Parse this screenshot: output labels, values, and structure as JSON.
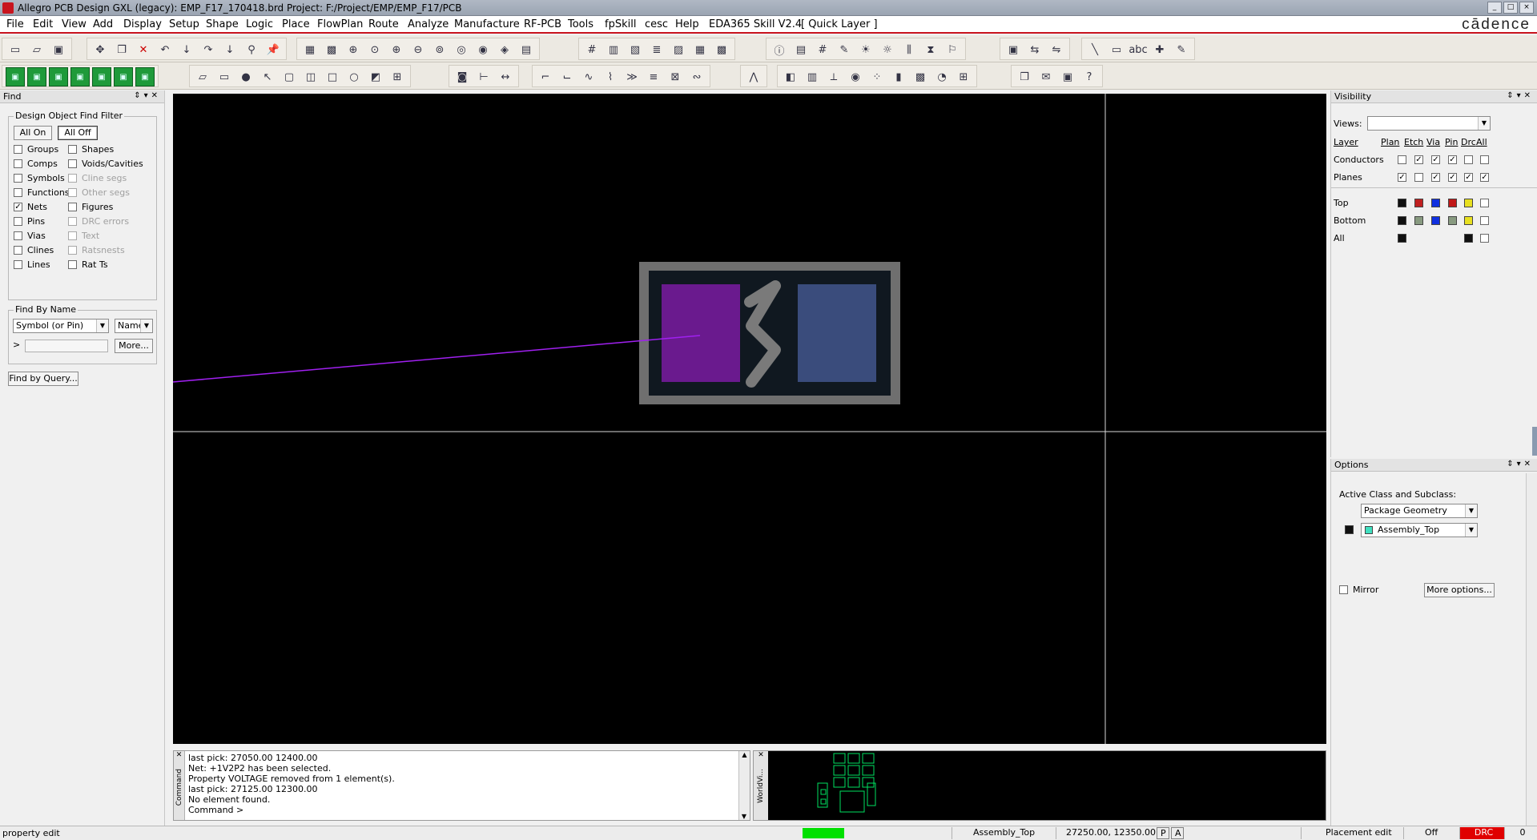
{
  "window": {
    "title": "Allegro PCB Design GXL (legacy): EMP_F17_170418.brd  Project: F:/Project/EMP/EMP_F17/PCB",
    "brand": "cādence"
  },
  "menu": [
    "File",
    "Edit",
    "View",
    "Add",
    "Display",
    "Setup",
    "Shape",
    "Logic",
    "Place",
    "FlowPlan",
    "Route",
    "Analyze",
    "Manufacture",
    "RF-PCB",
    "Tools",
    "fpSkill",
    "cesc",
    "Help",
    "EDA365 Skill V2.4",
    "[ Quick Layer ]"
  ],
  "find_panel": {
    "header": "Find",
    "filter_title": "Design Object Find Filter",
    "all_on": "All On",
    "all_off": "All Off",
    "left_items": [
      {
        "label": "Groups",
        "checked": false,
        "enabled": true
      },
      {
        "label": "Comps",
        "checked": false,
        "enabled": true
      },
      {
        "label": "Symbols",
        "checked": false,
        "enabled": true
      },
      {
        "label": "Functions",
        "checked": false,
        "enabled": true
      },
      {
        "label": "Nets",
        "checked": true,
        "enabled": true
      },
      {
        "label": "Pins",
        "checked": false,
        "enabled": true
      },
      {
        "label": "Vias",
        "checked": false,
        "enabled": true
      },
      {
        "label": "Clines",
        "checked": false,
        "enabled": true
      },
      {
        "label": "Lines",
        "checked": false,
        "enabled": true
      }
    ],
    "right_items": [
      {
        "label": "Shapes",
        "checked": false,
        "enabled": true
      },
      {
        "label": "Voids/Cavities",
        "checked": false,
        "enabled": true
      },
      {
        "label": "Cline segs",
        "checked": false,
        "enabled": false
      },
      {
        "label": "Other segs",
        "checked": false,
        "enabled": false
      },
      {
        "label": "Figures",
        "checked": false,
        "enabled": true
      },
      {
        "label": "DRC errors",
        "checked": false,
        "enabled": false
      },
      {
        "label": "Text",
        "checked": false,
        "enabled": false
      },
      {
        "label": "Ratsnests",
        "checked": false,
        "enabled": false
      },
      {
        "label": "Rat Ts",
        "checked": false,
        "enabled": true
      }
    ],
    "find_by_name_title": "Find By Name",
    "type_select": "Symbol (or Pin)",
    "name_select": "Name",
    "prompt": ">",
    "more": "More...",
    "find_by_query": "Find by Query..."
  },
  "visibility_panel": {
    "header": "Visibility",
    "views_label": "Views:",
    "views_value": "",
    "columns": [
      "Layer",
      "Plan",
      "Etch",
      "Via",
      "Pin",
      "Drc",
      "All"
    ],
    "rows": [
      {
        "label": "Conductors",
        "checks": [
          false,
          true,
          true,
          true,
          false,
          false
        ]
      },
      {
        "label": "Planes",
        "checks": [
          true,
          false,
          true,
          true,
          true,
          true
        ]
      }
    ],
    "layers": [
      {
        "label": "Top",
        "colors": [
          "#101010",
          "#c02020",
          "#1030e0",
          "#c01818",
          "#e8e020"
        ]
      },
      {
        "label": "Bottom",
        "colors": [
          "#101010",
          "#889a80",
          "#1030e0",
          "#889a80",
          "#e8e020"
        ]
      },
      {
        "label": "All",
        "colors": [
          "#101010",
          "",
          "",
          "",
          "#101010"
        ]
      }
    ]
  },
  "options_panel": {
    "header": "Options",
    "active_class_label": "Active Class and Subclass:",
    "class_value": "Package Geometry",
    "subclass_value": "Assembly_Top",
    "subclass_color": "#40e0c0",
    "mirror_label": "Mirror",
    "more_options": "More options..."
  },
  "command_window": {
    "side_label": "Command",
    "lines": [
      "last pick:  27050.00 12400.00",
      "Net: +1V2P2 has been selected.",
      "Property VOLTAGE removed from 1 element(s).",
      "last pick:  27125.00 12300.00",
      "No element found.",
      "Command >"
    ]
  },
  "worldview": {
    "side_label": "WorldVi..."
  },
  "statusbar": {
    "left_text": "property edit",
    "subclass": "Assembly_Top",
    "coords": "27250.00, 12350.00",
    "p": "P",
    "a": "A",
    "mode": "Placement edit",
    "off": "Off",
    "drc": "DRC",
    "count": "0",
    "ready_color": "#00e000",
    "drc_color": "#e00000"
  }
}
